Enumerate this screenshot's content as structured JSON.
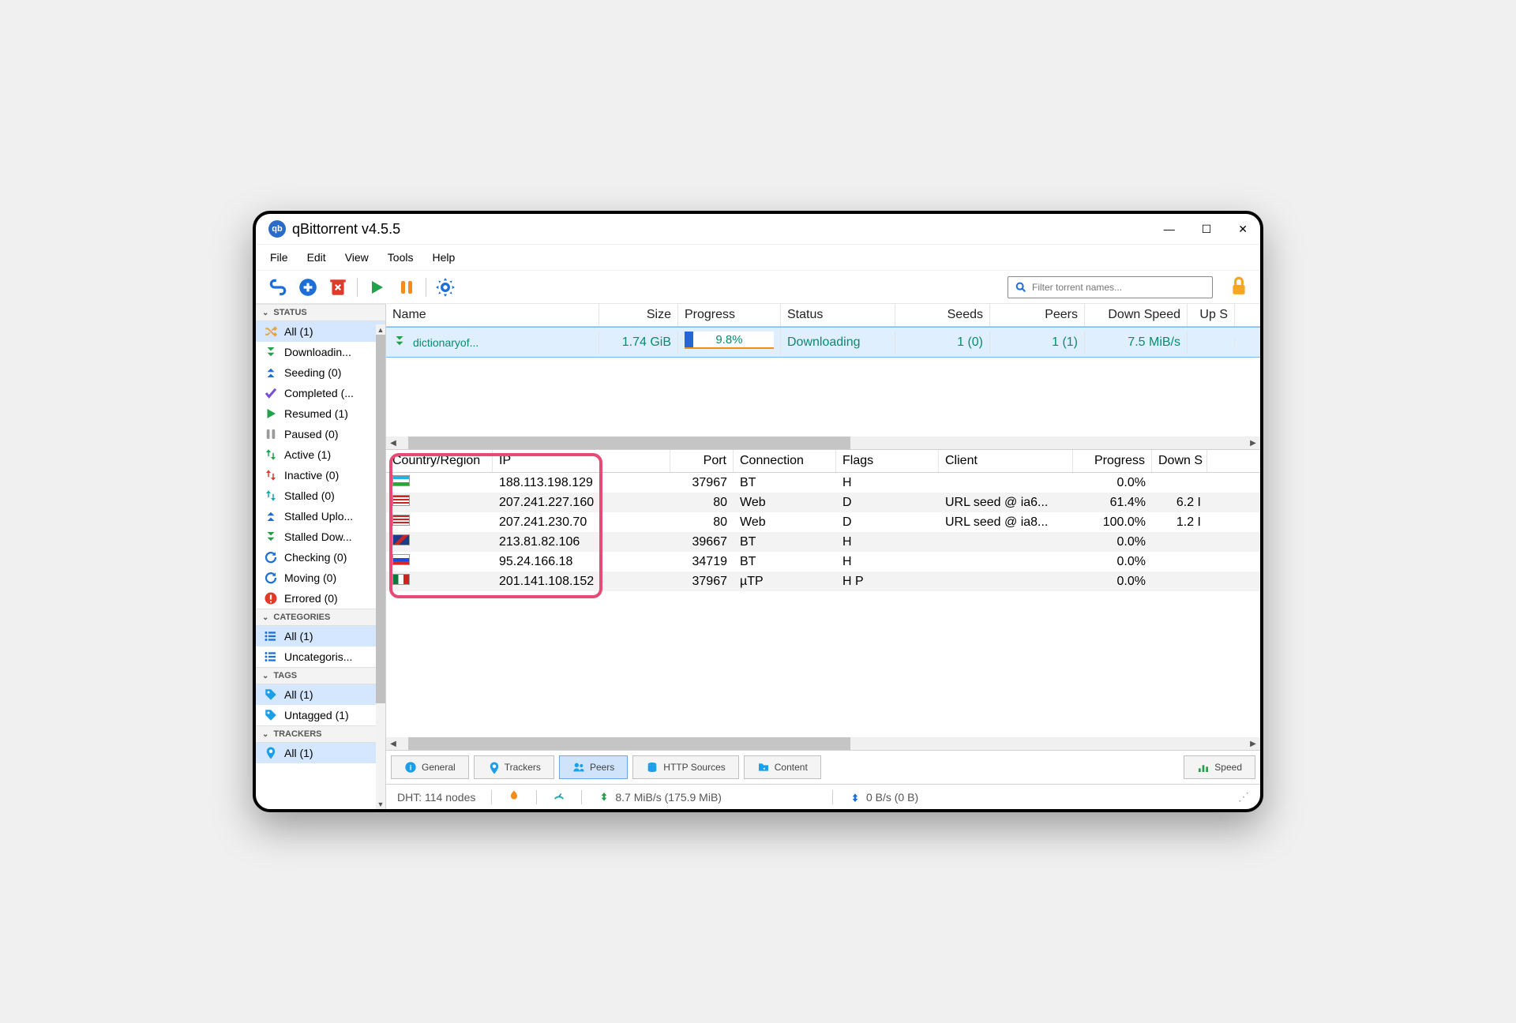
{
  "window": {
    "title": "qBittorrent v4.5.5"
  },
  "menu": [
    "File",
    "Edit",
    "View",
    "Tools",
    "Help"
  ],
  "search": {
    "placeholder": "Filter torrent names..."
  },
  "sidebar": {
    "sections": [
      {
        "title": "STATUS",
        "items": [
          {
            "label": "All (1)",
            "icon": "shuffle",
            "color": "#e8a13a",
            "sel": true
          },
          {
            "label": "Downloadin...",
            "icon": "down2",
            "color": "#22a04a"
          },
          {
            "label": "Seeding (0)",
            "icon": "up2",
            "color": "#1b6fd6"
          },
          {
            "label": "Completed (...",
            "icon": "check",
            "color": "#7a4fd6"
          },
          {
            "label": "Resumed (1)",
            "icon": "play",
            "color": "#22a04a"
          },
          {
            "label": "Paused (0)",
            "icon": "pause",
            "color": "#9a9a9a"
          },
          {
            "label": "Active (1)",
            "icon": "updown",
            "color": "#22a04a"
          },
          {
            "label": "Inactive (0)",
            "icon": "updown",
            "color": "#e03b2a"
          },
          {
            "label": "Stalled (0)",
            "icon": "updown",
            "color": "#18a6b6"
          },
          {
            "label": "Stalled Uplo...",
            "icon": "up2",
            "color": "#1b6fd6"
          },
          {
            "label": "Stalled Dow...",
            "icon": "down2",
            "color": "#22a04a"
          },
          {
            "label": "Checking (0)",
            "icon": "refresh",
            "color": "#1b6fd6"
          },
          {
            "label": "Moving (0)",
            "icon": "refresh",
            "color": "#1b6fd6"
          },
          {
            "label": "Errored (0)",
            "icon": "error",
            "color": "#e03b2a"
          }
        ]
      },
      {
        "title": "CATEGORIES",
        "items": [
          {
            "label": "All (1)",
            "icon": "list",
            "color": "#1b6fd6",
            "sel": true
          },
          {
            "label": "Uncategoris...",
            "icon": "list",
            "color": "#1b6fd6"
          }
        ]
      },
      {
        "title": "TAGS",
        "items": [
          {
            "label": "All (1)",
            "icon": "tag",
            "color": "#1b9fe8",
            "sel": true
          },
          {
            "label": "Untagged (1)",
            "icon": "tag",
            "color": "#1b9fe8"
          }
        ]
      },
      {
        "title": "TRACKERS",
        "items": [
          {
            "label": "All (1)",
            "icon": "pin",
            "color": "#1b9fe8",
            "sel": true
          }
        ]
      }
    ]
  },
  "torrents": {
    "headers": [
      "Name",
      "Size",
      "Progress",
      "Status",
      "Seeds",
      "Peers",
      "Down Speed",
      "Up S"
    ],
    "rows": [
      {
        "name": "dictionaryof...",
        "size": "1.74 GiB",
        "progress": "9.8%",
        "progressPct": 9.8,
        "status": "Downloading",
        "seeds": "1 (0)",
        "peers": "1 (1)",
        "down": "7.5 MiB/s",
        "up": ""
      }
    ]
  },
  "peers": {
    "headers": [
      "Country/Region",
      "IP",
      "Port",
      "Connection",
      "Flags",
      "Client",
      "Progress",
      "Down S"
    ],
    "rows": [
      {
        "flag": "uz",
        "ip": "188.113.198.129",
        "port": "37967",
        "conn": "BT",
        "flags": "H",
        "client": "",
        "progress": "0.0%",
        "down": ""
      },
      {
        "flag": "us",
        "ip": "207.241.227.160",
        "port": "80",
        "conn": "Web",
        "flags": "D",
        "client": "URL seed @ ia6...",
        "progress": "61.4%",
        "down": "6.2 I"
      },
      {
        "flag": "us",
        "ip": "207.241.230.70",
        "port": "80",
        "conn": "Web",
        "flags": "D",
        "client": "URL seed @ ia8...",
        "progress": "100.0%",
        "down": "1.2 I"
      },
      {
        "flag": "gb",
        "ip": "213.81.82.106",
        "port": "39667",
        "conn": "BT",
        "flags": "H",
        "client": "",
        "progress": "0.0%",
        "down": ""
      },
      {
        "flag": "ru",
        "ip": "95.24.166.18",
        "port": "34719",
        "conn": "BT",
        "flags": "H",
        "client": "",
        "progress": "0.0%",
        "down": ""
      },
      {
        "flag": "mx",
        "ip": "201.141.108.152",
        "port": "37967",
        "conn": "µTP",
        "flags": "H P",
        "client": "",
        "progress": "0.0%",
        "down": ""
      }
    ]
  },
  "tabs": [
    {
      "label": "General",
      "icon": "info"
    },
    {
      "label": "Trackers",
      "icon": "pin"
    },
    {
      "label": "Peers",
      "icon": "peers",
      "active": true
    },
    {
      "label": "HTTP Sources",
      "icon": "db"
    },
    {
      "label": "Content",
      "icon": "folder"
    }
  ],
  "speedTab": {
    "label": "Speed"
  },
  "statusbar": {
    "dht": "DHT: 114 nodes",
    "down": "8.7 MiB/s (175.9 MiB)",
    "up": "0 B/s (0 B)"
  },
  "flagStyles": {
    "uz": "linear-gradient(#1eb5e0 33%,#fff 33% 66%,#2aa53b 66%)",
    "us": "repeating-linear-gradient(#c22 0 2px,#fff 2px 4px)",
    "gb": "linear-gradient(135deg,#1a3b8c 40%,#c22 40% 60%,#1a3b8c 60%)",
    "ru": "linear-gradient(#fff 33%,#1a4bd0 33% 66%,#d22 66%)",
    "mx": "linear-gradient(90deg,#0a7a3c 33%,#fff 33% 66%,#c22 66%)"
  }
}
